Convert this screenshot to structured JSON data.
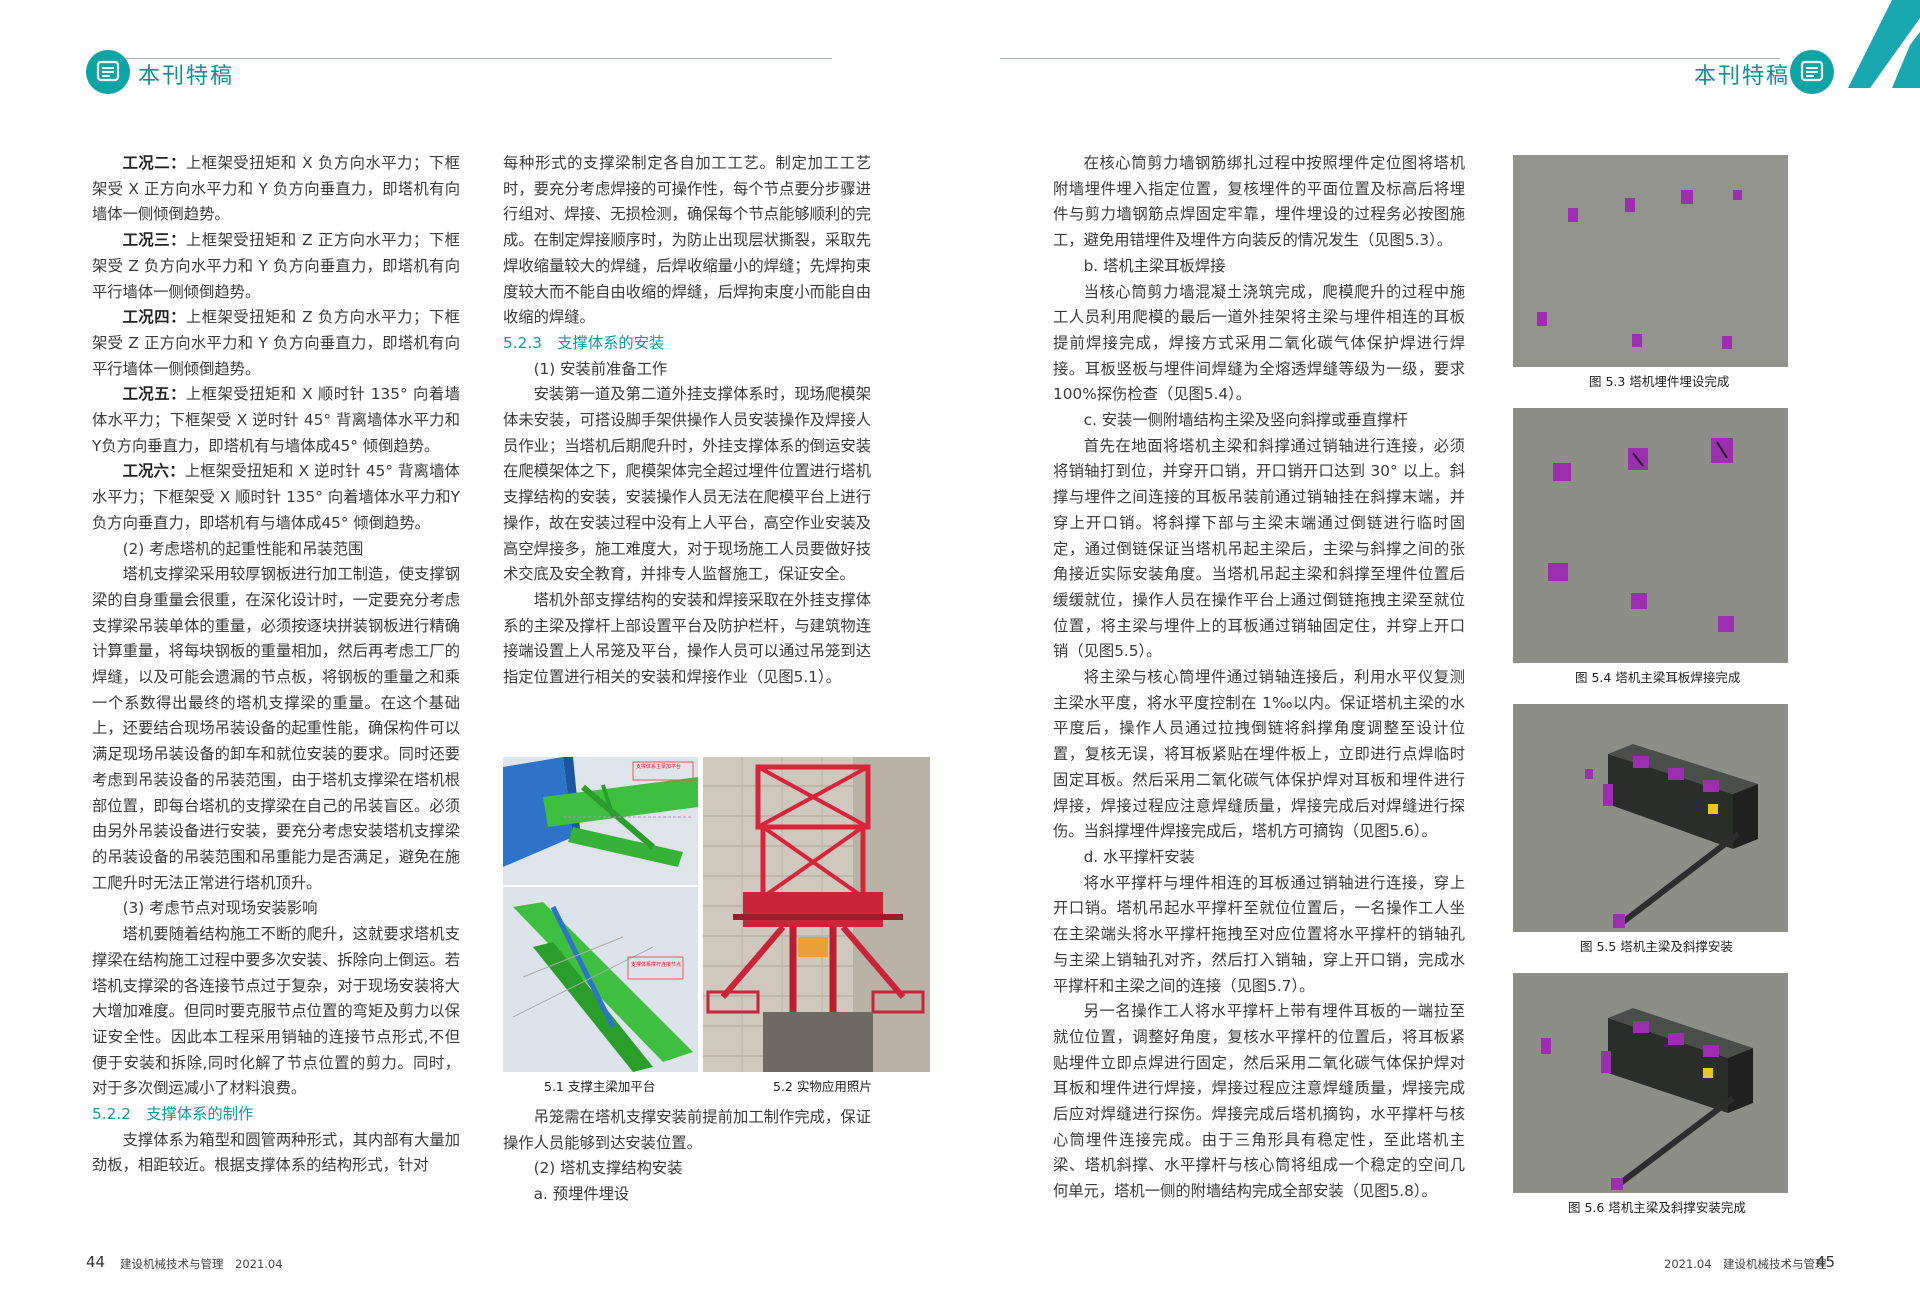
{
  "header": {
    "left_title": "本刊特稿",
    "right_title": "本刊特稿"
  },
  "left_page": {
    "col1": [
      {
        "lead": "工况二：",
        "text": "上框架受扭矩和 X 负方向水平力；下框架受 X 正方向水平力和 Y 负方向垂直力，即塔机有向墙体一侧倾倒趋势。"
      },
      {
        "lead": "工况三：",
        "text": "上框架受扭矩和 Z 正方向水平力；下框架受 Z 负方向水平力和 Y 负方向垂直力，即塔机有向平行墙体一侧倾倒趋势。"
      },
      {
        "lead": "工况四：",
        "text": "上框架受扭矩和 Z 负方向水平力；下框架受 Z 正方向水平力和 Y 负方向垂直力，即塔机有向平行墙体一侧倾倒趋势。"
      },
      {
        "lead": "工况五：",
        "text": "上框架受扭矩和 X 顺时针 135° 向着墙体水平力；下框架受 X 逆时针 45° 背离墙体水平力和Y负方向垂直力，即塔机有与墙体成45° 倾倒趋势。"
      },
      {
        "lead": "工况六：",
        "text": "上框架受扭矩和 X 逆时针 45° 背离墙体水平力；下框架受 X 顺时针 135° 向着墙体水平力和Y负方向垂直力，即塔机有与墙体成45° 倾倒趋势。"
      },
      {
        "lead": "",
        "text": "(2) 考虑塔机的起重性能和吊装范围"
      },
      {
        "lead": "",
        "text": "塔机支撑梁采用较厚钢板进行加工制造，使支撑钢梁的自身重量会很重，在深化设计时，一定要充分考虑支撑梁吊装单体的重量，必须按逐块拼装钢板进行精确计算重量，将每块钢板的重量相加，然后再考虑工厂的焊缝，以及可能会遗漏的节点板，将钢板的重量之和乘一个系数得出最终的塔机支撑梁的重量。在这个基础上，还要结合现场吊装设备的起重性能，确保构件可以满足现场吊装设备的卸车和就位安装的要求。同时还要考虑到吊装设备的吊装范围，由于塔机支撑梁在塔机根部位置，即每台塔机的支撑梁在自己的吊装盲区。必须由另外吊装设备进行安装，要充分考虑安装塔机支撑梁的吊装设备的吊装范围和吊重能力是否满足，避免在施工爬升时无法正常进行塔机顶升。"
      },
      {
        "lead": "",
        "text": "(3) 考虑节点对现场安装影响"
      },
      {
        "lead": "",
        "text": "塔机要随着结构施工不断的爬升，这就要求塔机支撑梁在结构施工过程中要多次安装、拆除向上倒运。若塔机支撑梁的各连接节点过于复杂，对于现场安装将大大增加难度。但同时要克服节点位置的弯矩及剪力以保证安全性。因此本工程采用销轴的连接节点形式,不但便于安装和拆除,同时化解了节点位置的剪力。同时，对于多次倒运减小了材料浪费。"
      }
    ],
    "col1_heading": "5.2.2　支撑体系的制作",
    "col1_tail": "支撑体系为箱型和圆管两种形式，其内部有大量加劲板，相距较近。根据支撑体系的结构形式，针对",
    "col2_a": "每种形式的支撑梁制定各自加工工艺。制定加工工艺时，要充分考虑焊接的可操作性，每个节点要分步骤进行组对、焊接、无损检测，确保每个节点能够顺利的完成。在制定焊接顺序时，为防止出现层状撕裂，采取先焊收缩量较大的焊缝，后焊收缩量小的焊缝；先焊拘束度较大而不能自由收缩的焊缝，后焊拘束度小而能自由收缩的焊缝。",
    "col2_heading": "5.2.3　支撑体系的安装",
    "col2_b": [
      "(1) 安装前准备工作",
      "安装第一道及第二道外挂支撑体系时，现场爬模架体未安装，可搭设脚手架供操作人员安装操作及焊接人员作业；当塔机后期爬升时，外挂支撑体系的倒运安装在爬模架体之下，爬模架体完全超过埋件位置进行塔机支撑结构的安装，安装操作人员无法在爬模平台上进行操作，故在安装过程中没有上人平台，高空作业安装及高空焊接多，施工难度大，对于现场施工人员要做好技术交底及安全教育，并排专人监督施工，保证安全。",
      "塔机外部支撑结构的安装和焊接采取在外挂支撑体系的主梁及撑杆上部设置平台及防护栏杆，与建筑物连接端设置上人吊笼及平台，操作人员可以通过吊笼到达指定位置进行相关的安装和焊接作业（见图5.1）。"
    ],
    "fig_inner_label": "支撑体系主梁加平台",
    "fig_inner_label2": "支撑体系撑杆连接节点",
    "cap_51": "5.1  支撑主梁加平台",
    "cap_52": "5.2  实物应用照片",
    "col2_c": [
      "吊笼需在塔机支撑安装前提前加工制作完成，保证操作人员能够到达安装位置。",
      "(2) 塔机支撑结构安装",
      "a. 预埋件埋设"
    ],
    "page_no": "44",
    "journal": "建设机械技术与管理　2021.04"
  },
  "right_page": {
    "col3": [
      "在核心筒剪力墙钢筋绑扎过程中按照埋件定位图将塔机附墙埋件埋入指定位置，复核埋件的平面位置及标高后将埋件与剪力墙钢筋点焊固定牢靠，埋件埋设的过程务必按图施工，避免用错埋件及埋件方向装反的情况发生（见图5.3）。",
      "b. 塔机主梁耳板焊接",
      "当核心筒剪力墙混凝土浇筑完成，爬模爬升的过程中施工人员利用爬模的最后一道外挂架将主梁与埋件相连的耳板提前焊接完成，焊接方式采用二氧化碳气体保护焊进行焊接。耳板竖板与埋件间焊缝为全熔透焊缝等级为一级，要求100%探伤检查（见图5.4）。",
      "c. 安装一侧附墙结构主梁及竖向斜撑或垂直撑杆",
      "首先在地面将塔机主梁和斜撑通过销轴进行连接，必须将销轴打到位，并穿开口销，开口销开口达到 30° 以上。斜撑与埋件之间连接的耳板吊装前通过销轴挂在斜撑末端，并穿上开口销。将斜撑下部与主梁末端通过倒链进行临时固定，通过倒链保证当塔机吊起主梁后，主梁与斜撑之间的张角接近实际安装角度。当塔机吊起主梁和斜撑至埋件位置后缓缓就位，操作人员在操作平台上通过倒链拖拽主梁至就位位置，将主梁与埋件上的耳板通过销轴固定住，并穿上开口销（见图5.5）。",
      "将主梁与核心筒埋件通过销轴连接后，利用水平仪复测主梁水平度，将水平度控制在 1‰以内。保证塔机主梁的水平度后，操作人员通过拉拽倒链将斜撑角度调整至设计位置，复核无误，将耳板紧贴在埋件板上，立即进行点焊临时固定耳板。然后采用二氧化碳气体保护焊对耳板和埋件进行焊接，焊接过程应注意焊缝质量，焊接完成后对焊缝进行探伤。当斜撑埋件焊接完成后，塔机方可摘钩（见图5.6）。",
      "d. 水平撑杆安装",
      "将水平撑杆与埋件相连的耳板通过销轴进行连接，穿上开口销。塔机吊起水平撑杆至就位位置后，一名操作工人坐在主梁端头将水平撑杆拖拽至对应位置将水平撑杆的销轴孔与主梁上销轴孔对齐，然后打入销轴，穿上开口销，完成水平撑杆和主梁之间的连接（见图5.7）。",
      "另一名操作工人将水平撑杆上带有埋件耳板的一端拉至就位位置，调整好角度，复核水平撑杆的位置后，将耳板紧贴埋件立即点焊进行固定，然后采用二氧化碳气体保护焊对耳板和埋件进行焊接，焊接过程应注意焊缝质量，焊接完成后应对焊缝进行探伤。焊接完成后塔机摘钩，水平撑杆与核心筒埋件连接完成。由于三角形具有稳定性，至此塔机主梁、塔机斜撑、水平撑杆与核心筒将组成一个稳定的空间几何单元，塔机一侧的附墙结构完成全部安装（见图5.8）。"
    ],
    "cap_53": "图 5.3  塔机埋件埋设完成",
    "cap_54": "图 5.4  塔机主梁耳板焊接完成",
    "cap_55": "图 5.5  塔机主梁及斜撑安装",
    "cap_56": "图 5.6  塔机主梁及斜撑安装完成",
    "page_no": "45",
    "journal": "2021.04　建设机械技术与管理"
  },
  "colors": {
    "teal": "#0ea4a6",
    "heading": "#0f97a4",
    "purple": "#9b2fb0",
    "concrete": "#8d8f86"
  }
}
